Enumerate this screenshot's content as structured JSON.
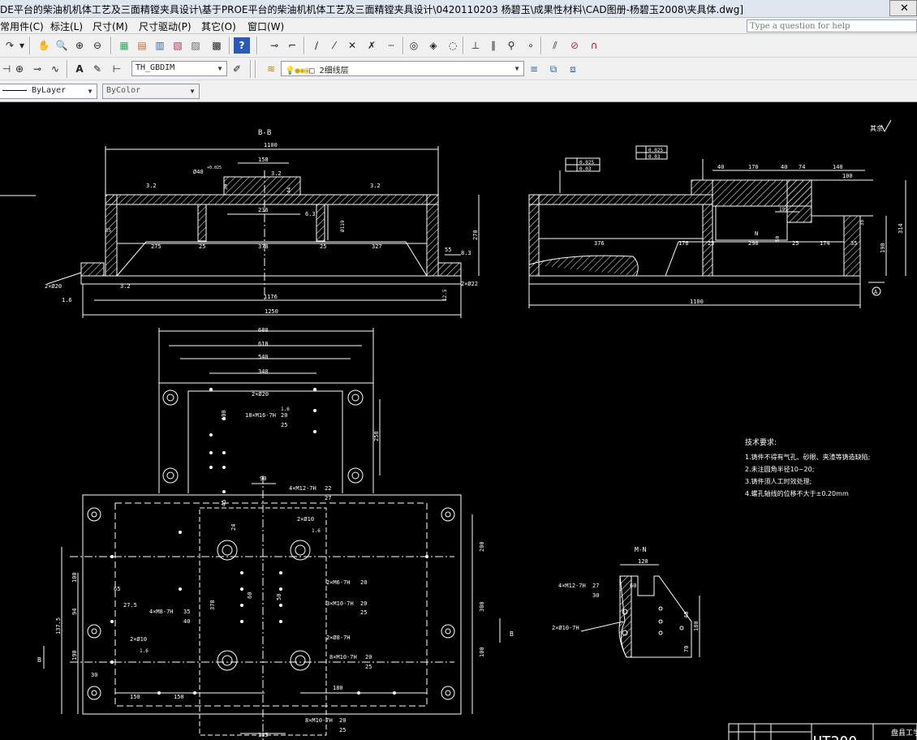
{
  "window": {
    "title": "DE平台的柴油机机体工艺及三面精镗夹具设计\\基于PROE平台的柴油机机体工艺及三面精镗夹具设计\\0420110203 杨碧玉\\成果性材料\\CAD图册-杨碧玉2008\\夹具体.dwg]"
  },
  "menu": {
    "items": [
      "常用件(C)",
      "标注(L)",
      "尺寸(M)",
      "尺寸驱动(P)",
      "其它(O)",
      "窗口(W)"
    ],
    "help_placeholder": "Type a question for help"
  },
  "toolbar2": {
    "dimstyle": "TH_GBDIM",
    "layer": "2细线层"
  },
  "toolbar3": {
    "linetype": "ByLayer",
    "color": "ByColor"
  },
  "drawing": {
    "section_bb": "B-B",
    "section_mn": "M-N",
    "datum_a": "A",
    "datum_b": "B",
    "surface_finish": "其余",
    "tech_requirements": {
      "heading": "技术要求:",
      "items": [
        "1.铸件不得有气孔、砂眼、夹渣等铸造缺陷;",
        "2.未注圆角半径10~20;",
        "3.铸件须人工时效处理;",
        "4.螺孔轴线的位移不大于±0.20mm"
      ]
    },
    "title_block": {
      "material": "HT200",
      "text": "盘县工学"
    },
    "top_view_dims": {
      "overall": "1100",
      "inner_top": "158",
      "bore": "Ø40",
      "bore_tol": "+0.025",
      "rough1": "3.2",
      "rough2": "3.2",
      "rough3": "3.2",
      "dim236": "236",
      "dim6_3": "6.3",
      "dim44": "44",
      "dim30": "30",
      "dim119": "Ø119",
      "dim35": "35",
      "dim270": "270",
      "dim275": "275",
      "dim25a": "25",
      "dim378": "378",
      "dim25b": "25",
      "dim327": "327",
      "dim55": "55",
      "dim8_3": "8.3",
      "dim2x20": "2×Ø20",
      "dim1_6": "1.6",
      "dim3_2b": "3.2",
      "dim1176": "1176",
      "dim12_5": "12.5",
      "dim2x22": "2×Ø22",
      "dim1250": "1250"
    },
    "side_view_dims": {
      "tol1": "0.025",
      "tol2": "0.03",
      "tol3": "0.025",
      "tol4": "0.03",
      "d40a": "40",
      "d170": "170",
      "d40b": "40",
      "d74": "74",
      "d140": "140",
      "d100": "100",
      "d199": "199",
      "d35": "35",
      "d314": "314",
      "d190": "190",
      "dN": "N",
      "d376": "376",
      "d176": "176",
      "d25a": "25",
      "d290": "290",
      "d25b": "25",
      "d174": "174",
      "d35b": "35",
      "d1100": "1100",
      "d50": "50"
    },
    "plan_view_dims": {
      "d680": "680",
      "d618": "618",
      "d540": "540",
      "d340": "340",
      "d2x20": "2×Ø20",
      "d1_6": "1.6",
      "d18m16": "18×M16-7H",
      "d20": "20",
      "d25": "25",
      "d258": "258",
      "d90": "90",
      "d4m12": "4×M12-7H",
      "d22": "22",
      "d27": "27",
      "d2x10": "2×Ø10",
      "d1_6b": "1.6",
      "d2m6": "2×M6-7H",
      "d20b": "20",
      "d3m10": "3×M10-7H",
      "d20c": "20",
      "d25b": "25",
      "d2x8": "2×Ø8-7H",
      "d8m10": "8×M10-7H",
      "d20d": "20",
      "d25c": "25",
      "d4m8": "4×M8-7H",
      "d35": "35",
      "d40": "40",
      "d2x10b": "2×Ø10",
      "d1_6c": "1.6",
      "d8m10b": "8×M10-7H",
      "d20e": "20",
      "d25d": "25",
      "d135": "135",
      "d150a": "150",
      "d150b": "150",
      "d180": "180",
      "d30": "30",
      "d200": "200",
      "d300": "300",
      "d100": "100",
      "d137_5": "137.5",
      "d94": "94",
      "d190": "190",
      "d100b": "100",
      "d378": "378",
      "d27_5": "27.5",
      "d65": "65",
      "d100c": "100",
      "d45": "45",
      "d24": "24",
      "d60": "60",
      "d50": "50"
    },
    "mn_view_dims": {
      "d120": "120",
      "d60": "60",
      "d4m12": "4×M12-7H",
      "d27": "27",
      "d30": "30",
      "d2x10": "2×Ø10-7H",
      "d40": "40",
      "d180": "180",
      "d70": "70"
    }
  }
}
